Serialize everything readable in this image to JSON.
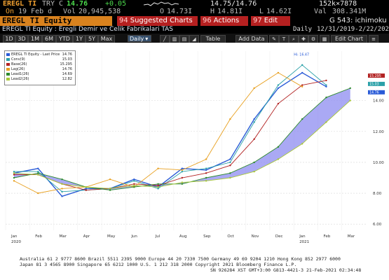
{
  "header": {
    "ticker": "EREGL TI",
    "currency": "TRY",
    "price_flag": "C",
    "last_price": "14.76",
    "change": "+0.05",
    "bid_ask": "14.75/14.76",
    "size": "152k×7878",
    "on_label": "On",
    "date": "19 Feb d",
    "vol_label": "Vol",
    "volume": "20,945,538",
    "open_label": "O",
    "open": "14.73I",
    "high_label": "H",
    "high": "14.81I",
    "low_label": "L",
    "low": "14.62I",
    "val_label": "Val",
    "value": "308.341M"
  },
  "toolbar": {
    "input_value": "EREGL TI Equity",
    "suggested_num": "94",
    "suggested_label": "Suggested Charts",
    "actions_num": "96",
    "actions_label": "Actions",
    "edit_num": "97",
    "edit_label": "Edit",
    "page_label": "G 543: ichimoku"
  },
  "titlebar": {
    "title": "EREGL TI Equity : Eregli Demir ve Celik Fabrikalari TAS",
    "period": "Daily",
    "date_range": "12/31/2019-2/22/2021"
  },
  "controls": {
    "ranges": [
      "1D",
      "3D",
      "1M",
      "6M",
      "YTD",
      "1Y",
      "5Y",
      "Max"
    ],
    "frequency": "Daily",
    "frequency_arrow": "▾",
    "table_label": "Table",
    "add_data_label": "Add Data",
    "edit_chart_label": "Edit Chart"
  },
  "legend": {
    "items": [
      {
        "name": "EREGL TI Equity - Last Price",
        "value": "14.76",
        "color": "#2a5bd7"
      },
      {
        "name": "Conv(9)",
        "value": "15.03",
        "color": "#2aa0a8"
      },
      {
        "name": "Base(26)",
        "value": "15.295",
        "color": "#b22222"
      },
      {
        "name": "Lag(26)",
        "value": "14.76",
        "color": "#e8a020"
      },
      {
        "name": "Lead1(26)",
        "value": "14.69",
        "color": "#2d8a2d"
      },
      {
        "name": "Lead2(26)",
        "value": "12.82",
        "color": "#a8c838"
      }
    ]
  },
  "chart_data": {
    "type": "line",
    "title": "EREGL TI Equity : Eregli Demir ve Celik Fabrikalari TAS",
    "x_labels": [
      "Jan",
      "Feb",
      "Mar",
      "Apr",
      "May",
      "Jun",
      "Jul",
      "Aug",
      "Sep",
      "Oct",
      "Nov",
      "Dec",
      "Jan",
      "Feb",
      "Mar"
    ],
    "x_year_label": "2020",
    "x_year_label_2": "2021",
    "y_ticks": [
      6.0,
      8.0,
      10.0,
      12.0,
      14.0
    ],
    "ylim": [
      5.6,
      17.2
    ],
    "max_annotation": "Hi: 16.47",
    "right_labels": [
      "15.295",
      "15.03",
      "14.76"
    ],
    "right_label_colors": [
      "#b22222",
      "#2aa0a8",
      "#2a5bd7"
    ],
    "x": [
      0,
      1,
      2,
      3,
      4,
      5,
      6,
      7,
      8,
      9,
      10,
      11,
      12,
      13,
      14
    ],
    "series": [
      {
        "name": "EREGL TI Equity - Last Price",
        "color": "#2a5bd7",
        "values": [
          9.3,
          9.6,
          7.8,
          8.3,
          8.3,
          8.9,
          8.4,
          9.6,
          9.5,
          10.2,
          12.8,
          14.8,
          15.8,
          14.9,
          null
        ]
      },
      {
        "name": "Conv(9)",
        "color": "#2aa0a8",
        "values": [
          9.4,
          9.4,
          8.1,
          8.2,
          8.3,
          8.8,
          8.3,
          9.4,
          9.6,
          10.0,
          12.6,
          15.0,
          16.3,
          15.0,
          null
        ]
      },
      {
        "name": "Base(26)",
        "color": "#b22222",
        "values": [
          9.2,
          9.2,
          8.6,
          8.2,
          8.3,
          8.6,
          8.5,
          9.0,
          9.3,
          9.8,
          11.5,
          13.8,
          15.0,
          15.3,
          null
        ]
      },
      {
        "name": "Lag(26)",
        "color": "#e8a020",
        "values": [
          8.8,
          8.0,
          8.3,
          8.4,
          8.9,
          8.4,
          9.6,
          9.5,
          10.2,
          12.8,
          14.8,
          15.8,
          14.9,
          null,
          null
        ]
      },
      {
        "name": "Lead1(26)",
        "color": "#2d8a2d",
        "values": [
          9.0,
          9.3,
          8.9,
          8.4,
          8.2,
          8.4,
          8.6,
          8.6,
          9.0,
          9.3,
          10.0,
          11.0,
          12.8,
          14.2,
          14.8
        ]
      },
      {
        "name": "Lead2(26)",
        "color": "#a8c838",
        "values": [
          9.3,
          9.2,
          8.6,
          8.4,
          8.3,
          8.5,
          8.4,
          8.7,
          8.8,
          9.0,
          9.4,
          10.2,
          11.2,
          12.6,
          14.0
        ]
      }
    ]
  },
  "footer": {
    "line1": "Australia 61 2 9777 8600  Brazil 5511 2395 9000  Europe 44 20 7330 7500  Germany 49 69 9204 1210  Hong Kong 852 2977 6000",
    "line2": "Japan 81 3 4565 8900        Singapore 65 6212 1000        U.S. 1 212 318 2000        Copyright 2021 Bloomberg Finance L.P.",
    "line3": "SN 926284 XST  GMT+3:00 G813-4421-3 21-Feb-2021 02:34:48"
  }
}
